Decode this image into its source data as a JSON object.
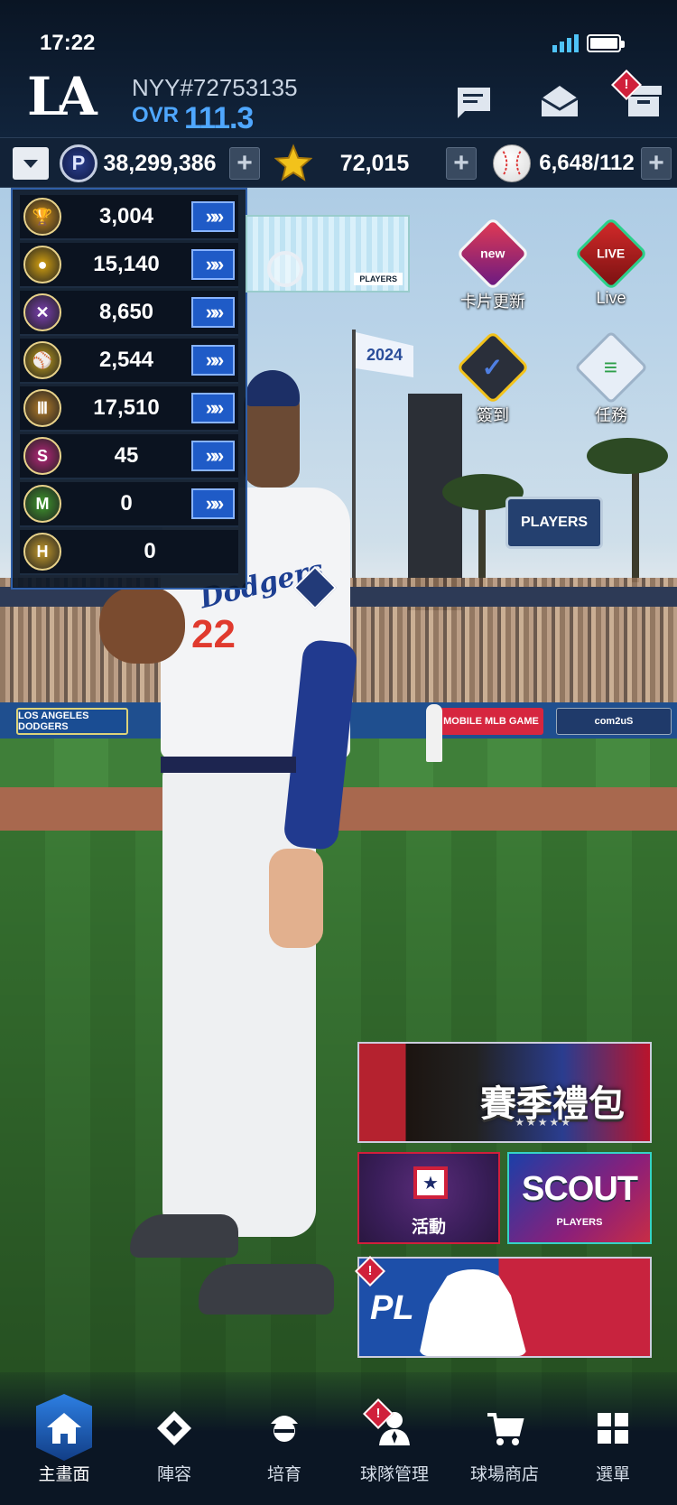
{
  "status_bar": {
    "time": "17:22"
  },
  "header": {
    "team_logo": "LA",
    "user_id": "NYY#72753135",
    "ovr_label": "OVR",
    "ovr_value": "111.3",
    "icons": [
      "chat-icon",
      "mail-icon",
      "inventory-icon"
    ],
    "alert_badge": "!"
  },
  "currencies": [
    {
      "icon": "p-coin-icon",
      "value": "38,299,386"
    },
    {
      "icon": "star-icon",
      "value": "72,015"
    },
    {
      "icon": "baseball-icon",
      "value": "6,648/112"
    }
  ],
  "resources": [
    {
      "icon": "trophy-medal-icon",
      "value": "3,004",
      "color": "#c98a1b",
      "has_go": true
    },
    {
      "icon": "glove-medal-icon",
      "value": "15,140",
      "color": "#d6a20f",
      "has_go": true
    },
    {
      "icon": "bat-medal-icon",
      "value": "8,650",
      "color": "#7b3fb1",
      "has_go": true
    },
    {
      "icon": "player-medal-icon",
      "value": "2,544",
      "color": "#c5a21c",
      "has_go": true
    },
    {
      "icon": "stadium-medal-icon",
      "value": "17,510",
      "color": "#b57d29",
      "has_go": true
    },
    {
      "icon": "s-coin-icon",
      "value": "45",
      "color": "#b6267a",
      "has_go": true
    },
    {
      "icon": "m-badge-icon",
      "value": "0",
      "color": "#3f9a2d",
      "has_go": true
    },
    {
      "icon": "h-coin-icon",
      "value": "0",
      "color": "#c79d2b",
      "has_go": false
    }
  ],
  "top_banner": {
    "brand_text": "PLAYERS"
  },
  "side_icons": [
    {
      "label": "卡片更新",
      "badge": "new"
    },
    {
      "label": "Live",
      "badge": "LIVE"
    },
    {
      "label": "簽到",
      "badge": "✓"
    },
    {
      "label": "任務",
      "badge": "≡"
    }
  ],
  "scene": {
    "flag_text": "2024",
    "sign_text": "PLAYERS",
    "ad_boards": [
      "LOS ANGELES DODGERS",
      "MOBILE MLB GAME",
      "com2uS"
    ],
    "jersey_script": "Dodgers",
    "jersey_number": "22"
  },
  "promos": {
    "season_pack_title": "賽季禮包",
    "season_pack_stars": "★★★★★",
    "event_label": "活動",
    "scout_title": "SCOUT",
    "scout_sub": "PLAYERS",
    "pl_label": "PL"
  },
  "bottom_nav": [
    {
      "label": "主畫面",
      "icon": "home-icon",
      "active": true
    },
    {
      "label": "陣容",
      "icon": "diamond-field-icon",
      "active": false
    },
    {
      "label": "培育",
      "icon": "coach-icon",
      "active": false
    },
    {
      "label": "球隊管理",
      "icon": "manager-icon",
      "active": false
    },
    {
      "label": "球場商店",
      "icon": "cart-icon",
      "active": false
    },
    {
      "label": "選單",
      "icon": "menu-grid-icon",
      "active": false
    }
  ]
}
